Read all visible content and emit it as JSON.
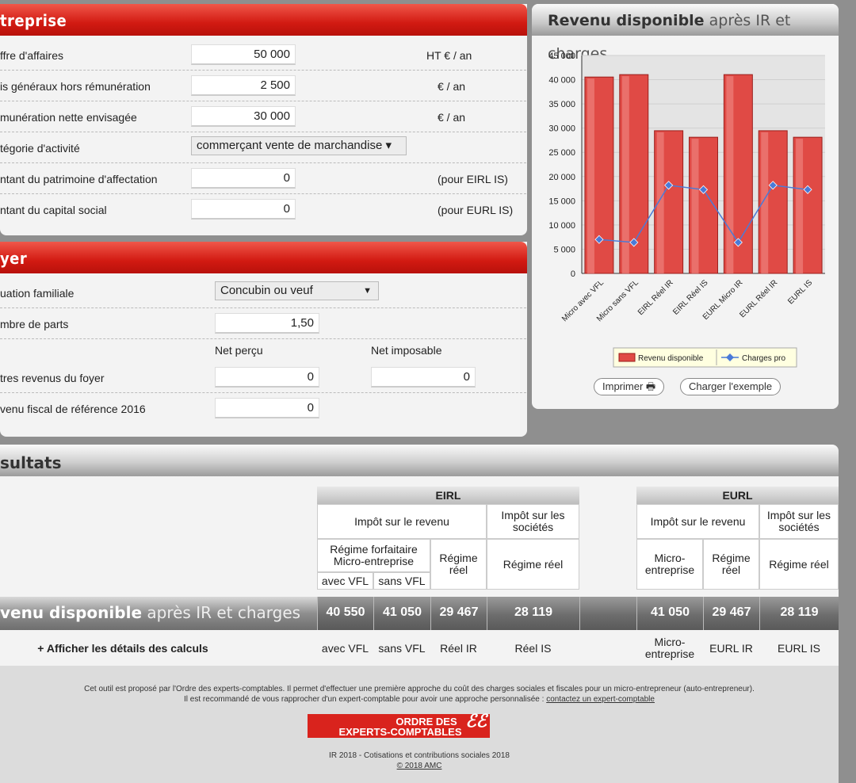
{
  "entreprise": {
    "title": "treprise",
    "rows": [
      {
        "label": "ffre d'affaires",
        "value": "50 000",
        "unit": "HT € / an"
      },
      {
        "label": "is généraux hors rémunération",
        "value": "2 500",
        "unit": "€ / an"
      },
      {
        "label": "munération nette envisagée",
        "value": "30 000",
        "unit": "€ / an"
      },
      {
        "label": "tégorie d'activité",
        "value": "commerçant vente de marchandise ▾",
        "unit": ""
      },
      {
        "label": "ntant du patrimoine d'affectation",
        "value": "0",
        "unit": "(pour EIRL IS)"
      },
      {
        "label": "ntant du capital social",
        "value": "0",
        "unit": "(pour EURL IS)"
      }
    ]
  },
  "foyer": {
    "title": "yer",
    "situation_label": "uation familiale",
    "situation_value": "Concubin ou veuf",
    "parts_label": "mbre de parts",
    "parts_value": "1,50",
    "col_net_percu": "Net perçu",
    "col_net_imposable": "Net imposable",
    "autres_label": "tres revenus du foyer",
    "autres_percu": "0",
    "autres_imposable": "0",
    "rfr_label": "venu fiscal de référence 2016",
    "rfr_value": "0"
  },
  "chart_panel": {
    "title_bold": "Revenu disponible",
    "title_rest": " après IR et charges",
    "print_label": "Imprimer",
    "example_label": "Charger l'exemple"
  },
  "chart_data": {
    "type": "bar",
    "title": "Revenu disponible après IR et charges",
    "categories": [
      "Micro avec VFL",
      "Micro sans VFL",
      "EIRL Réel IR",
      "EIRL Réel IS",
      "EURL Micro IR",
      "EURL Réel IR",
      "EURL IS"
    ],
    "series": [
      {
        "name": "Revenu disponible",
        "type": "bar",
        "values": [
          40550,
          41050,
          29467,
          28119,
          41050,
          29467,
          28119
        ],
        "color": "#e04a45"
      },
      {
        "name": "Charges pro",
        "type": "line",
        "values": [
          7000,
          6400,
          18200,
          17300,
          6400,
          18200,
          17300
        ],
        "color": "#4a7ad8"
      }
    ],
    "yticks": [
      "45 000",
      "40 000",
      "35 000",
      "30 000",
      "25 000",
      "20 000",
      "15 000",
      "10 000",
      "5 000",
      "0"
    ],
    "ylim": [
      0,
      45000
    ],
    "legend": "bottom",
    "grid": true
  },
  "results": {
    "title": "sultats",
    "eirl": "EIRL",
    "eurl": "EURL",
    "impot_revenu": "Impôt sur le revenu",
    "impot_societes": "Impôt sur les sociétés",
    "regime_forfaitaire": "Régime forfaitaire Micro-entreprise",
    "regime_reel": "Régime réel",
    "regime_reel_short": "Régime réel",
    "avec_vfl": "avec VFL",
    "sans_vfl": "sans VFL",
    "micro_entreprise": "Micro-entreprise",
    "rd_bold": "venu disponible",
    "rd_rest": " après IR et charges",
    "values": [
      "40 550",
      "41 050",
      "29 467",
      "28 119",
      "41 050",
      "29 467",
      "28 119"
    ],
    "details_label": "+ Afficher les détails des calculs",
    "footer_cols": [
      "avec VFL",
      "sans VFL",
      "Réel IR",
      "Réel IS",
      "Micro-entreprise",
      "EURL IR",
      "EURL IS"
    ]
  },
  "footer": {
    "line1": "Cet outil est proposé par l'Ordre des experts-comptables. Il permet d'effectuer une première approche du coût des charges sociales et fiscales pour un micro-entrepreneur (auto-entrepreneur).",
    "line2_prefix": "Il est recommandé de vous rapprocher d'un expert-comptable pour avoir une approche personnalisée : ",
    "line2_link": "contactez un expert-comptable",
    "logo_line1": "ORDRE DES",
    "logo_line2": "EXPERTS-COMPTABLES",
    "ir": "IR 2018 - Cotisations et contributions sociales 2018",
    "copyright": "© 2018 AMC"
  }
}
